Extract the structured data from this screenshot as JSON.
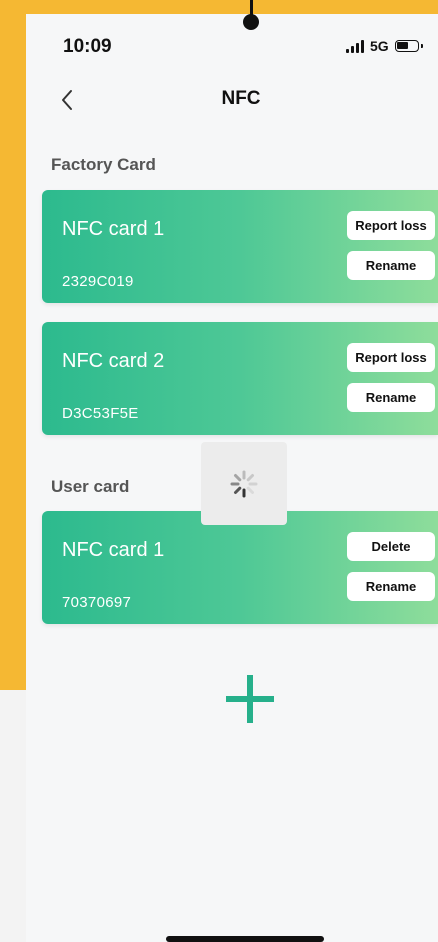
{
  "status_bar": {
    "time": "10:09",
    "network": "5G"
  },
  "nav": {
    "title": "NFC",
    "back_icon": "chevron-left-icon"
  },
  "sections": [
    {
      "label": "Factory Card",
      "cards": [
        {
          "name": "NFC card 1",
          "id": "2329C019",
          "primary_action": "Report loss",
          "secondary_action": "Rename"
        },
        {
          "name": "NFC card 2",
          "id": "D3C53F5E",
          "primary_action": "Report loss",
          "secondary_action": "Rename"
        }
      ]
    },
    {
      "label": "User card",
      "cards": [
        {
          "name": "NFC card 1",
          "id": "70370697",
          "primary_action": "Delete",
          "secondary_action": "Rename"
        }
      ]
    }
  ],
  "add_icon": "plus-icon",
  "colors": {
    "background": "#f5b833",
    "card_gradient_start": "#2cba8e",
    "card_gradient_end": "#8edd9b",
    "accent": "#26b08b"
  }
}
